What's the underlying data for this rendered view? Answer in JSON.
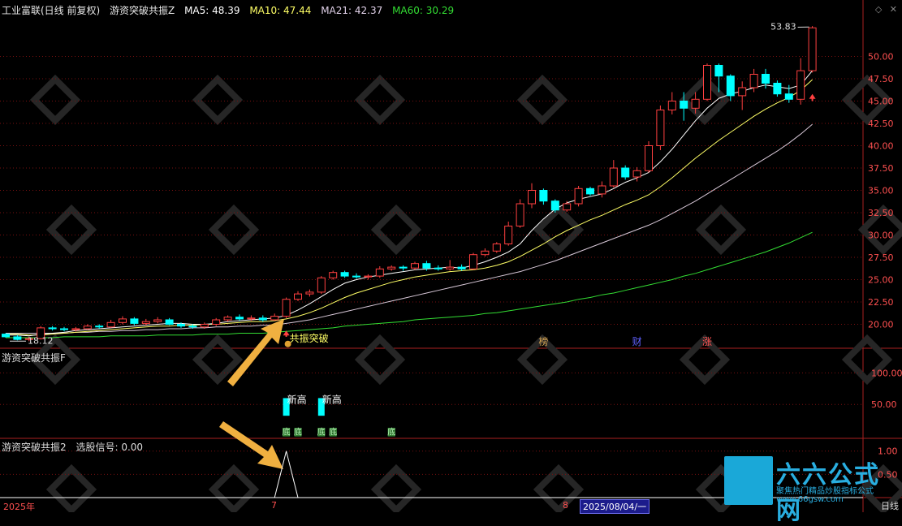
{
  "header": {
    "stock": "工业富联(日线 前复权)",
    "indicator": "游资突破共振Z",
    "ma5": "MA5: 48.39",
    "ma10": "MA10: 47.44",
    "ma21": "MA21: 42.37",
    "ma60": "MA60: 30.29"
  },
  "sub1": {
    "title": "游资突破共振F",
    "label_new_high": "新高",
    "marker_char": "底"
  },
  "sub2": {
    "title": "游资突破共振2",
    "signal": "选股信号: 0.00"
  },
  "axis": {
    "year_label": "2025年",
    "month_7": "7",
    "month_8": "8",
    "date_box": "2025/08/04/一",
    "period": "日线"
  },
  "annotations": {
    "resonance_break": "共振突破",
    "max_label": "53.83",
    "min_label": "18.12",
    "badge_bang": "榜",
    "badge_cai": "财",
    "badge_zhang": "涨"
  },
  "logo": {
    "title": "六六公式网",
    "subtitle": "聚焦热门精品炒股指标公式",
    "url": "www.66gsw.com"
  },
  "colors": {
    "up": "#ff4040",
    "down": "#00ffff",
    "ma5": "#ffffff",
    "ma10": "#ffff66",
    "ma21": "#d8c8d8",
    "ma60": "#33dd33",
    "grid": "#7a1010",
    "axis": "#aa2020"
  },
  "chart_data": {
    "type": "candlestick",
    "price_axis": {
      "ylim": [
        17.5,
        54.5
      ],
      "ticks": [
        20.0,
        22.5,
        25.0,
        27.5,
        30.0,
        32.5,
        35.0,
        37.5,
        40.0,
        42.5,
        45.0,
        47.5,
        50.0
      ]
    },
    "candles": [
      [
        18.9,
        18.6,
        19.0,
        18.5
      ],
      [
        18.6,
        18.3,
        18.8,
        18.2
      ],
      [
        18.3,
        18.4,
        18.6,
        18.1
      ],
      [
        18.4,
        19.6,
        19.8,
        18.3
      ],
      [
        19.6,
        19.5,
        19.8,
        19.3
      ],
      [
        19.5,
        19.4,
        19.7,
        19.2
      ],
      [
        19.4,
        19.5,
        19.7,
        19.2
      ],
      [
        19.5,
        19.8,
        20.0,
        19.4
      ],
      [
        19.8,
        19.7,
        20.0,
        19.5
      ],
      [
        19.7,
        20.2,
        20.5,
        19.6
      ],
      [
        20.2,
        20.6,
        20.9,
        20.0
      ],
      [
        20.6,
        20.1,
        20.8,
        19.9
      ],
      [
        20.1,
        20.3,
        20.6,
        19.9
      ],
      [
        20.3,
        20.5,
        20.8,
        20.1
      ],
      [
        20.5,
        20.0,
        20.7,
        19.9
      ],
      [
        20.0,
        19.8,
        20.2,
        19.6
      ],
      [
        19.8,
        19.7,
        20.0,
        19.5
      ],
      [
        19.7,
        20.0,
        20.2,
        19.5
      ],
      [
        20.0,
        20.5,
        20.7,
        19.8
      ],
      [
        20.5,
        20.8,
        21.0,
        20.3
      ],
      [
        20.8,
        20.6,
        21.1,
        20.4
      ],
      [
        20.6,
        20.7,
        21.0,
        20.4
      ],
      [
        20.7,
        20.5,
        21.0,
        20.3
      ],
      [
        20.5,
        20.9,
        21.2,
        20.4
      ],
      [
        20.9,
        22.8,
        23.0,
        20.7
      ],
      [
        22.8,
        23.4,
        23.7,
        22.6
      ],
      [
        23.4,
        23.6,
        23.9,
        23.1
      ],
      [
        23.6,
        25.2,
        25.4,
        23.4
      ],
      [
        25.2,
        25.8,
        26.0,
        25.0
      ],
      [
        25.8,
        25.4,
        26.0,
        25.2
      ],
      [
        25.4,
        25.3,
        25.7,
        25.1
      ],
      [
        25.3,
        25.4,
        25.6,
        25.0
      ],
      [
        25.4,
        26.2,
        26.5,
        25.2
      ],
      [
        26.2,
        26.4,
        26.6,
        26.0
      ],
      [
        26.4,
        26.3,
        26.6,
        26.0
      ],
      [
        26.3,
        26.8,
        27.0,
        26.1
      ],
      [
        26.8,
        26.3,
        27.1,
        26.0
      ],
      [
        26.3,
        26.2,
        26.6,
        26.0
      ],
      [
        26.2,
        26.4,
        27.2,
        26.0
      ],
      [
        26.4,
        26.2,
        26.7,
        26.0
      ],
      [
        26.2,
        27.8,
        28.0,
        26.1
      ],
      [
        27.8,
        28.2,
        28.5,
        27.6
      ],
      [
        28.2,
        29.0,
        29.2,
        28.0
      ],
      [
        29.0,
        31.0,
        31.5,
        28.8
      ],
      [
        31.0,
        33.5,
        34.0,
        30.8
      ],
      [
        33.5,
        35.0,
        35.8,
        33.0
      ],
      [
        35.0,
        33.8,
        35.2,
        33.4
      ],
      [
        33.8,
        32.8,
        34.0,
        32.5
      ],
      [
        32.8,
        33.5,
        33.8,
        32.6
      ],
      [
        33.5,
        35.2,
        35.5,
        33.2
      ],
      [
        35.2,
        34.6,
        35.4,
        34.4
      ],
      [
        34.6,
        35.5,
        36.0,
        34.2
      ],
      [
        35.5,
        37.5,
        38.4,
        35.3
      ],
      [
        37.5,
        36.5,
        37.8,
        36.2
      ],
      [
        36.5,
        37.2,
        37.6,
        36.0
      ],
      [
        37.2,
        40.0,
        40.5,
        37.0
      ],
      [
        40.0,
        44.0,
        44.5,
        39.5
      ],
      [
        44.0,
        45.0,
        46.0,
        43.5
      ],
      [
        45.0,
        44.2,
        46.0,
        42.8
      ],
      [
        44.2,
        45.2,
        46.0,
        43.6
      ],
      [
        45.2,
        49.0,
        49.2,
        45.0
      ],
      [
        49.0,
        47.8,
        49.2,
        46.0
      ],
      [
        47.8,
        45.6,
        48.0,
        45.0
      ],
      [
        45.6,
        46.5,
        47.2,
        44.0
      ],
      [
        46.5,
        48.0,
        48.6,
        46.0
      ],
      [
        48.0,
        47.0,
        48.6,
        46.4
      ],
      [
        47.0,
        45.8,
        47.3,
        45.5
      ],
      [
        45.8,
        45.2,
        46.8,
        44.8
      ],
      [
        45.2,
        48.4,
        49.8,
        44.6
      ],
      [
        48.4,
        53.2,
        53.4,
        48.2
      ]
    ],
    "ma5": [
      18.8,
      18.8,
      18.7,
      18.9,
      19.0,
      19.1,
      19.3,
      19.4,
      19.5,
      19.6,
      19.7,
      19.8,
      19.9,
      20.0,
      20.1,
      20.1,
      20.0,
      20.0,
      20.1,
      20.3,
      20.4,
      20.5,
      20.6,
      20.7,
      21.0,
      21.6,
      22.3,
      23.1,
      23.9,
      24.6,
      25.0,
      25.3,
      25.5,
      25.7,
      25.9,
      26.1,
      26.2,
      26.3,
      26.4,
      26.3,
      26.6,
      27.0,
      27.5,
      28.1,
      29.0,
      30.5,
      31.8,
      32.9,
      33.6,
      34.0,
      34.3,
      34.6,
      35.2,
      35.9,
      36.4,
      37.0,
      38.2,
      39.6,
      41.2,
      42.8,
      44.2,
      45.3,
      45.8,
      46.1,
      46.5,
      46.8,
      46.6,
      46.4,
      46.8,
      48.4
    ],
    "ma10": [
      18.9,
      18.9,
      18.8,
      18.8,
      18.9,
      19.0,
      19.1,
      19.2,
      19.3,
      19.4,
      19.5,
      19.6,
      19.7,
      19.8,
      19.8,
      19.9,
      19.9,
      20.0,
      20.0,
      20.1,
      20.2,
      20.3,
      20.3,
      20.4,
      20.6,
      20.9,
      21.3,
      21.8,
      22.4,
      23.0,
      23.5,
      23.9,
      24.3,
      24.7,
      25.0,
      25.3,
      25.5,
      25.7,
      25.9,
      26.0,
      26.1,
      26.3,
      26.6,
      27.0,
      27.6,
      28.3,
      29.0,
      29.8,
      30.5,
      31.1,
      31.7,
      32.2,
      32.8,
      33.4,
      33.9,
      34.5,
      35.4,
      36.4,
      37.5,
      38.6,
      39.6,
      40.6,
      41.5,
      42.4,
      43.3,
      44.1,
      44.8,
      45.4,
      46.2,
      47.4
    ],
    "ma21": [
      19.0,
      19.0,
      19.0,
      19.0,
      19.0,
      19.0,
      19.1,
      19.1,
      19.2,
      19.2,
      19.3,
      19.3,
      19.4,
      19.4,
      19.5,
      19.5,
      19.6,
      19.6,
      19.7,
      19.7,
      19.8,
      19.8,
      19.9,
      19.9,
      20.1,
      20.3,
      20.5,
      20.8,
      21.1,
      21.4,
      21.7,
      22.0,
      22.3,
      22.6,
      22.9,
      23.2,
      23.5,
      23.8,
      24.1,
      24.4,
      24.7,
      25.0,
      25.3,
      25.6,
      25.9,
      26.3,
      26.7,
      27.1,
      27.6,
      28.1,
      28.6,
      29.1,
      29.6,
      30.1,
      30.6,
      31.1,
      31.7,
      32.4,
      33.1,
      33.8,
      34.6,
      35.4,
      36.2,
      37.0,
      37.8,
      38.6,
      39.4,
      40.3,
      41.3,
      42.4
    ],
    "ma60": [
      18.5,
      18.5,
      18.5,
      18.5,
      18.5,
      18.6,
      18.6,
      18.6,
      18.6,
      18.7,
      18.7,
      18.7,
      18.7,
      18.8,
      18.8,
      18.8,
      18.8,
      18.9,
      18.9,
      18.9,
      19.0,
      19.0,
      19.0,
      19.1,
      19.2,
      19.3,
      19.4,
      19.5,
      19.6,
      19.8,
      19.9,
      20.0,
      20.1,
      20.2,
      20.3,
      20.5,
      20.6,
      20.7,
      20.8,
      20.9,
      21.0,
      21.2,
      21.3,
      21.5,
      21.7,
      21.9,
      22.1,
      22.3,
      22.5,
      22.8,
      23.0,
      23.3,
      23.5,
      23.8,
      24.1,
      24.4,
      24.7,
      25.0,
      25.4,
      25.7,
      26.1,
      26.5,
      26.9,
      27.3,
      27.7,
      28.1,
      28.6,
      29.1,
      29.7,
      30.3
    ],
    "sub1": {
      "ylim": [
        0,
        125
      ],
      "ticks": [
        50.0,
        100.0
      ],
      "bars": [
        {
          "index": 24,
          "value": 32
        },
        {
          "index": 27,
          "value": 32
        }
      ]
    },
    "sub2": {
      "ylim": [
        0,
        1.1
      ],
      "ticks": [
        0.5,
        1.0
      ],
      "spike": {
        "center": 24,
        "halfwidth": 1,
        "peak": 1.0
      }
    }
  }
}
